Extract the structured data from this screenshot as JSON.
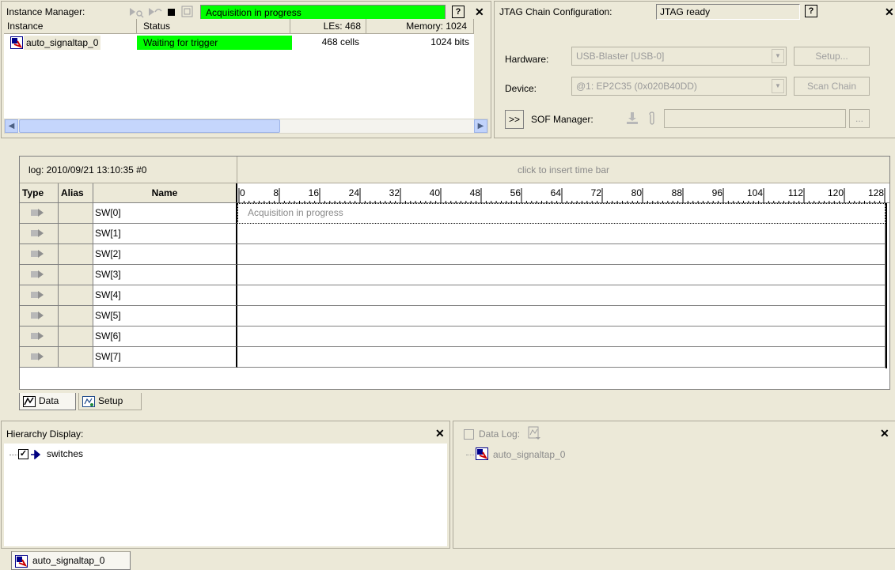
{
  "instance_manager": {
    "title": "Instance Manager:",
    "status_banner": "Acquisition in progress",
    "columns": {
      "instance": "Instance",
      "status": "Status",
      "les": "LEs: 468",
      "memory": "Memory: 1024"
    },
    "rows": [
      {
        "instance": "auto_signaltap_0",
        "status": "Waiting for trigger",
        "les": "468 cells",
        "memory": "1024 bits"
      }
    ],
    "help_label": "?",
    "status_color": "#00ff00"
  },
  "jtag": {
    "title": "JTAG Chain Configuration:",
    "status": "JTAG ready",
    "hardware_label": "Hardware:",
    "hardware_value": "USB-Blaster [USB-0]",
    "setup_button": "Setup...",
    "device_label": "Device:",
    "device_value": "@1: EP2C35 (0x020B40DD)",
    "scan_chain_button": "Scan Chain",
    "expand_button": ">>",
    "sof_label": "SOF Manager:",
    "browse_button": "..."
  },
  "waveform": {
    "log_label": "log: 2010/09/21 13:10:35  #0",
    "time_bar_hint": "click to insert time bar",
    "columns": {
      "type": "Type",
      "alias": "Alias",
      "name": "Name"
    },
    "ruler": [
      "0",
      "8",
      "16",
      "24",
      "32",
      "40",
      "48",
      "56",
      "64",
      "72",
      "80",
      "88",
      "96",
      "104",
      "112",
      "120",
      "128"
    ],
    "signals": [
      "SW[0]",
      "SW[1]",
      "SW[2]",
      "SW[3]",
      "SW[4]",
      "SW[5]",
      "SW[6]",
      "SW[7]"
    ],
    "first_row_message": "Acquisition in progress"
  },
  "tabs": {
    "data": "Data",
    "setup": "Setup"
  },
  "hierarchy": {
    "title": "Hierarchy Display:",
    "items": [
      {
        "label": "switches",
        "checked": true
      }
    ]
  },
  "data_log": {
    "title": "Data Log:",
    "items": [
      {
        "label": "auto_signaltap_0"
      }
    ]
  },
  "bottom_tab": {
    "label": "auto_signaltap_0"
  }
}
